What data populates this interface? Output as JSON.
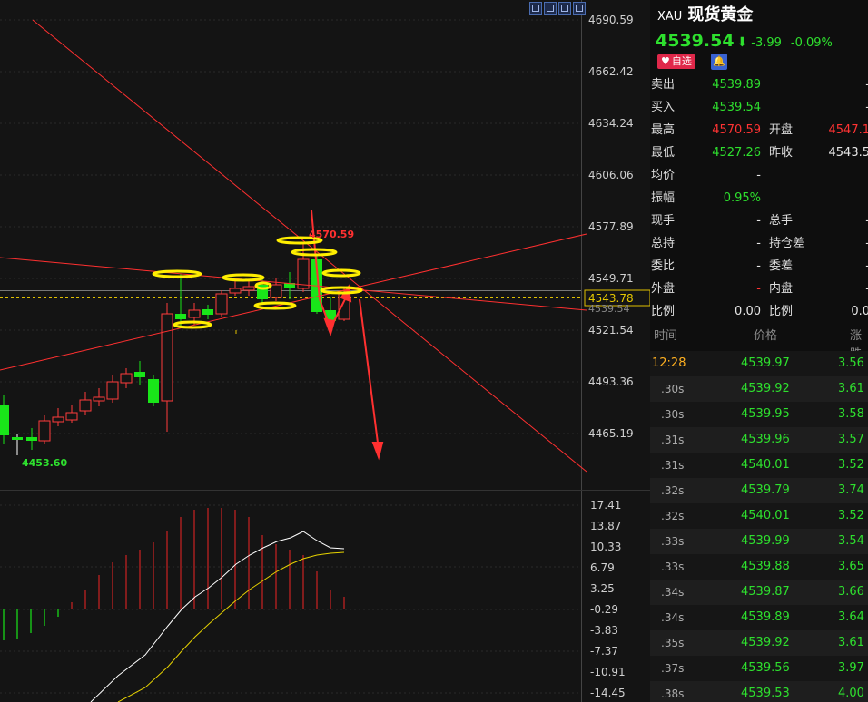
{
  "chart": {
    "price_axis": [
      "4690.59",
      "4662.42",
      "4634.24",
      "4606.06",
      "4577.89",
      "4549.71",
      "4521.54",
      "4493.36",
      "4465.19"
    ],
    "macd_axis": [
      "17.41",
      "13.87",
      "10.33",
      "6.79",
      "3.25",
      "-0.29",
      "-3.83",
      "-7.37",
      "-10.91",
      "-14.45"
    ],
    "current_price_label": "4543.78",
    "last_price_label": "4539.54",
    "high_label": "4570.59",
    "low_label": "4453.60",
    "colors": {
      "up": "#ff3b3b",
      "down": "#19e619",
      "guide": "#ff3030",
      "hilite": "#ffee00",
      "dif": "#ffffff",
      "dea": "#e6d200"
    }
  },
  "toolbar": [
    {
      "name": "crosshair-tool-icon"
    },
    {
      "name": "zoom-tool-icon"
    },
    {
      "name": "draw-tool-icon"
    },
    {
      "name": "expand-tool-icon"
    }
  ],
  "panel": {
    "symbol": "XAU",
    "name": "现货黄金",
    "price": "4539.54",
    "arrow": "⬇",
    "change": "-3.99",
    "change_pct": "-0.09%",
    "fav_label": "自选",
    "fav_icon": "heart-icon",
    "bell_icon": "bell-icon",
    "quotes": [
      {
        "k1": "卖出",
        "v1": "4539.89",
        "c1": "g",
        "k2": "",
        "v2": "-",
        "c2": "w"
      },
      {
        "k1": "买入",
        "v1": "4539.54",
        "c1": "g",
        "k2": "",
        "v2": "-",
        "c2": "w"
      },
      {
        "k1": "最高",
        "v1": "4570.59",
        "c1": "r",
        "k2": "开盘",
        "v2": "4547.1",
        "c2": "r"
      },
      {
        "k1": "最低",
        "v1": "4527.26",
        "c1": "g",
        "k2": "昨收",
        "v2": "4543.5",
        "c2": "w"
      },
      {
        "k1": "均价",
        "v1": "-",
        "c1": "w",
        "k2": "",
        "v2": "",
        "c2": "w"
      },
      {
        "k1": "振幅",
        "v1": "0.95%",
        "c1": "g",
        "k2": "",
        "v2": "",
        "c2": "w"
      },
      {
        "k1": "现手",
        "v1": "-",
        "c1": "w",
        "k2": "总手",
        "v2": "-",
        "c2": "w"
      },
      {
        "k1": "总持",
        "v1": "-",
        "c1": "w",
        "k2": "持仓差",
        "v2": "-",
        "c2": "w"
      },
      {
        "k1": "委比",
        "v1": "-",
        "c1": "w",
        "k2": "委差",
        "v2": "-",
        "c2": "w"
      },
      {
        "k1": "外盘",
        "v1": "-",
        "c1": "r",
        "k2": "内盘",
        "v2": "-",
        "c2": "w"
      },
      {
        "k1": "比例",
        "v1": "0.00",
        "c1": "w",
        "k2": "比例",
        "v2": "0.0",
        "c2": "w"
      }
    ],
    "tick_headers": {
      "time": "时间",
      "price": "价格",
      "change": "涨跌"
    },
    "ticks": [
      {
        "t": "12:28",
        "p": "4539.97",
        "d": "3.56",
        "first": true
      },
      {
        "t": ".30s",
        "p": "4539.92",
        "d": "3.61"
      },
      {
        "t": ".30s",
        "p": "4539.95",
        "d": "3.58"
      },
      {
        "t": ".31s",
        "p": "4539.96",
        "d": "3.57"
      },
      {
        "t": ".31s",
        "p": "4540.01",
        "d": "3.52"
      },
      {
        "t": ".32s",
        "p": "4539.79",
        "d": "3.74"
      },
      {
        "t": ".32s",
        "p": "4540.01",
        "d": "3.52"
      },
      {
        "t": ".33s",
        "p": "4539.99",
        "d": "3.54"
      },
      {
        "t": ".33s",
        "p": "4539.88",
        "d": "3.65"
      },
      {
        "t": ".34s",
        "p": "4539.87",
        "d": "3.66"
      },
      {
        "t": ".34s",
        "p": "4539.89",
        "d": "3.64"
      },
      {
        "t": ".35s",
        "p": "4539.92",
        "d": "3.61"
      },
      {
        "t": ".37s",
        "p": "4539.56",
        "d": "3.97"
      },
      {
        "t": ".38s",
        "p": "4539.53",
        "d": "4.00"
      }
    ]
  }
}
